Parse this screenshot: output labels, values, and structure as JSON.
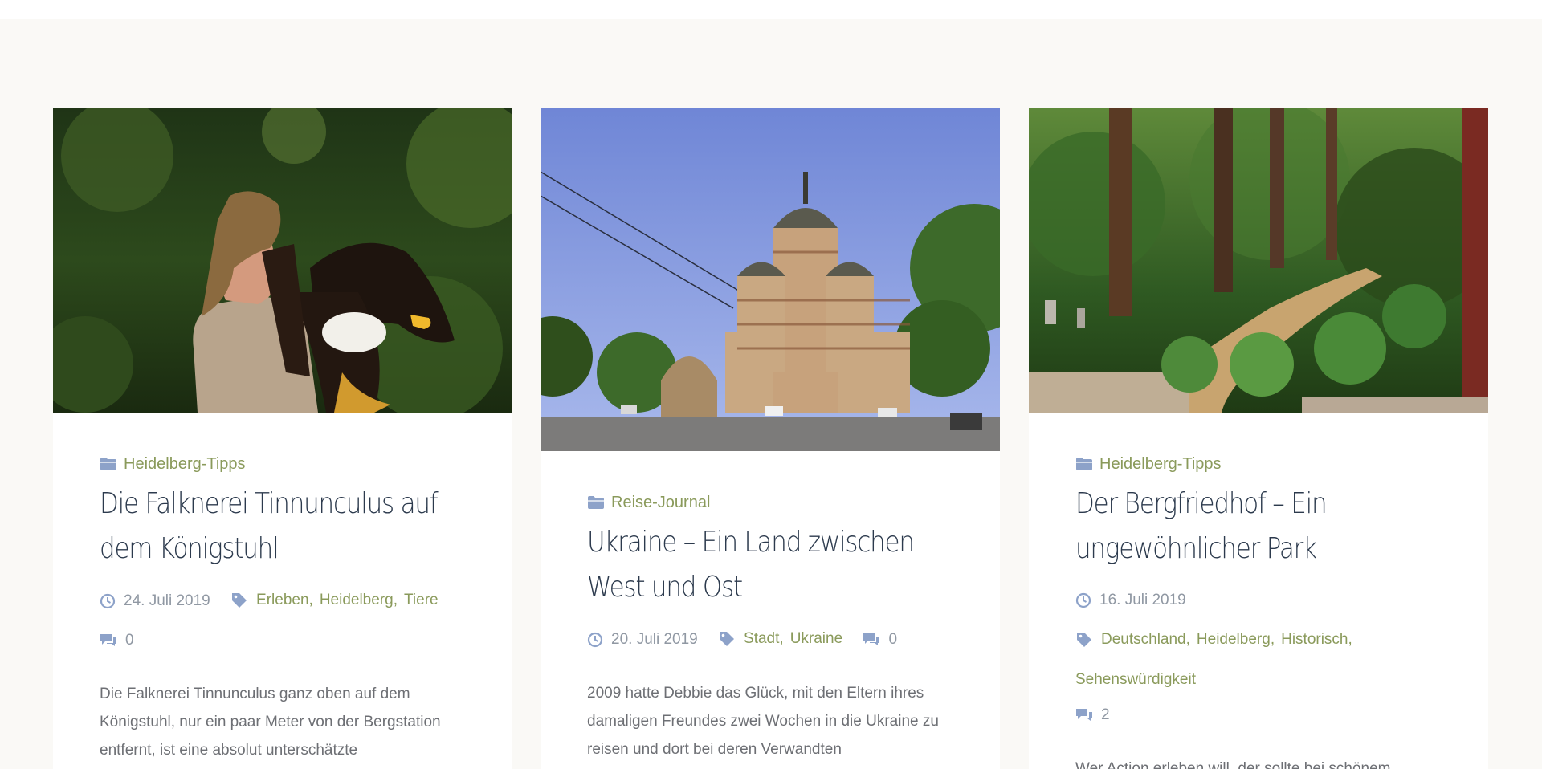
{
  "colors": {
    "accent": "#8a9a5b",
    "title": "#2c3a4d",
    "meta": "#9098a3",
    "icon": "#8da2c9",
    "background": "#faf9f6"
  },
  "posts": [
    {
      "image_alt": "falconer-with-eagle-photo",
      "category": "Heidelberg-Tipps",
      "title": "Die Falknerei Tinnunculus auf dem Königstuhl",
      "date": "24. Juli 2019",
      "tags": [
        "Erleben",
        "Heidelberg",
        "Tiere"
      ],
      "comments": "0",
      "excerpt": "Die Falknerei Tinnunculus ganz oben auf dem Königstuhl, nur ein paar Meter von der Bergstation entfernt, ist eine absolut unterschätzte"
    },
    {
      "image_alt": "cathedral-photo",
      "category": "Reise-Journal",
      "title": "Ukraine – Ein Land zwischen West und Ost",
      "date": "20. Juli 2019",
      "tags": [
        "Stadt",
        "Ukraine"
      ],
      "comments": "0",
      "excerpt": "2009 hatte Debbie das Glück, mit den Eltern ihres damaligen Freundes zwei Wochen in die Ukraine zu reisen und dort bei deren Verwandten"
    },
    {
      "image_alt": "cemetery-park-photo",
      "category": "Heidelberg-Tipps",
      "title": "Der Bergfriedhof – Ein ungewöhnlicher Park",
      "date": "16. Juli 2019",
      "tags": [
        "Deutschland",
        "Heidelberg",
        "Historisch",
        "Sehenswürdigkeit"
      ],
      "comments": "2",
      "excerpt": "Wer Action erleben will, der sollte bei schönem"
    }
  ]
}
